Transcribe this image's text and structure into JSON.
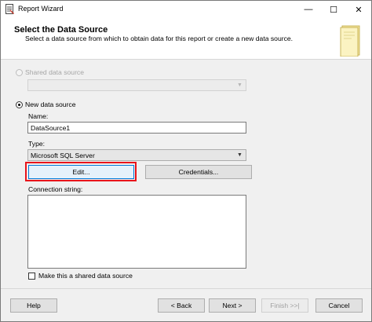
{
  "window": {
    "title": "Report Wizard",
    "minimize_glyph": "—",
    "maximize_glyph": "☐",
    "close_glyph": "✕",
    "icon": "report-wizard-icon"
  },
  "header": {
    "title": "Select the Data Source",
    "subtitle": "Select a data source from which to obtain data for this report or create a new data source.",
    "icon": "data-source-icon"
  },
  "shared_source": {
    "label": "Shared data source",
    "selected": false,
    "enabled": false,
    "value": ""
  },
  "new_source": {
    "label": "New data source",
    "selected": true,
    "name_label": "Name:",
    "name_value": "DataSource1",
    "type_label": "Type:",
    "type_value": "Microsoft SQL Server",
    "edit_label": "Edit...",
    "credentials_label": "Credentials...",
    "connection_label": "Connection string:",
    "connection_value": ""
  },
  "make_shared": {
    "label": "Make this a shared data source",
    "checked": false
  },
  "footer": {
    "help": "Help",
    "back": "< Back",
    "next": "Next >",
    "finish": "Finish >>|",
    "cancel": "Cancel"
  },
  "colors": {
    "highlight": "#e8141b",
    "focus": "#0078d7",
    "dialog_bg": "#f0f0f0"
  }
}
